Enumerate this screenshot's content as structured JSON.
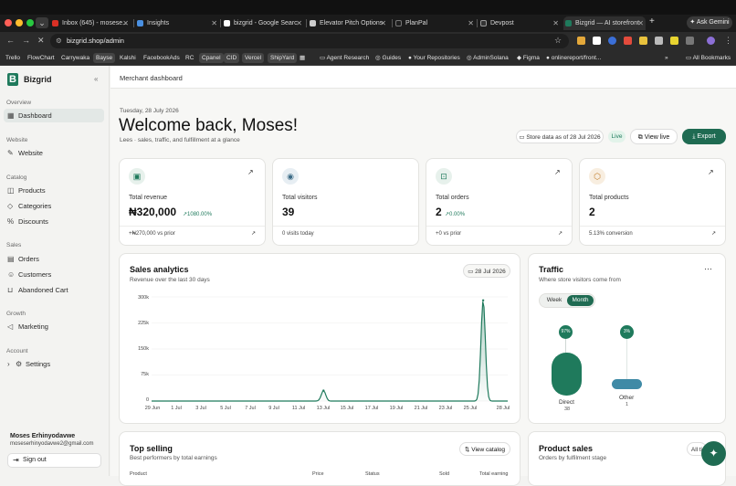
{
  "browser": {
    "tabs": [
      {
        "label": "Inbox (645) - mosese...",
        "fav": "#d93025"
      },
      {
        "label": "Insights",
        "fav": "#4a90e2"
      },
      {
        "label": "bizgrid - Google Searc",
        "fav": "#ffffff"
      },
      {
        "label": "Elevator Pitch Options",
        "fav": "#cccccc"
      },
      {
        "label": "PlanPal",
        "fav": "#1f1f1f"
      },
      {
        "label": "Devpost",
        "fav": "#333333"
      },
      {
        "label": "Bizgrid — AI storefront",
        "fav": "#1f7a5c"
      }
    ],
    "ask_gemini": "Ask Gemini",
    "url": "bizgrid.shop/admin",
    "bookmarks": [
      "Trello",
      "FlowChart",
      "Carrywaka",
      "Bayse",
      "Kalshi",
      "FacebookAds",
      "RC",
      "Cpanel",
      "CID",
      "Vercel",
      "ShipYard",
      "Agent Research",
      "Guides",
      "Your Repositories",
      "AdminSolana",
      "Figma",
      "onlinereport/front...",
      "All Bookmarks"
    ]
  },
  "sidebar": {
    "brand": "Bizgrid",
    "sections": {
      "overview": "Overview",
      "website": "Website",
      "catalog": "Catalog",
      "sales": "Sales",
      "growth": "Growth",
      "account": "Account"
    },
    "items": {
      "dashboard": "Dashboard",
      "website": "Website",
      "products": "Products",
      "categories": "Categories",
      "discounts": "Discounts",
      "orders": "Orders",
      "customers": "Customers",
      "abandoned": "Abandoned Cart",
      "marketing": "Marketing",
      "settings": "Settings"
    },
    "user": {
      "name": "Moses Erhinyodavwe",
      "email": "moseserhinyodavwe2@gmail.com"
    },
    "signout": "Sign out"
  },
  "header": {
    "breadcrumb": "Merchant dashboard"
  },
  "hero": {
    "date": "Tuesday, 28 July 2026",
    "title": "Welcome back, Moses!",
    "subtitle": "Lees · sales, traffic, and fulfillment at a glance",
    "store_data": "Store data as of 28 Jul 2026",
    "live": "Live",
    "view_live": "View live",
    "export": "Export"
  },
  "kpis": [
    {
      "label": "Total revenue",
      "value": "₦320,000",
      "delta": "↗1080.00%",
      "foot": "+₦270,000 vs prior"
    },
    {
      "label": "Total visitors",
      "value": "39",
      "delta": "",
      "foot": "0 visits today"
    },
    {
      "label": "Total orders",
      "value": "2",
      "delta": "↗0.00%",
      "foot": "+0 vs prior"
    },
    {
      "label": "Total products",
      "value": "2",
      "delta": "",
      "foot": "5.13% conversion"
    }
  ],
  "sales": {
    "title": "Sales analytics",
    "subtitle": "Revenue over the last 30 days",
    "date_chip": "28 Jul 2026"
  },
  "chart_data": {
    "type": "area",
    "title": "Sales analytics",
    "x": [
      "29 Jun",
      "30 Jun",
      "1 Jul",
      "2 Jul",
      "3 Jul",
      "4 Jul",
      "5 Jul",
      "6 Jul",
      "7 Jul",
      "8 Jul",
      "9 Jul",
      "10 Jul",
      "11 Jul",
      "12 Jul",
      "13 Jul",
      "14 Jul",
      "15 Jul",
      "16 Jul",
      "17 Jul",
      "18 Jul",
      "19 Jul",
      "20 Jul",
      "21 Jul",
      "22 Jul",
      "23 Jul",
      "24 Jul",
      "25 Jul",
      "26 Jul",
      "27 Jul",
      "28 Jul"
    ],
    "values": [
      0,
      0,
      0,
      0,
      0,
      0,
      0,
      0,
      0,
      0,
      0,
      0,
      0,
      0,
      30000,
      0,
      0,
      0,
      0,
      0,
      0,
      0,
      0,
      0,
      0,
      0,
      0,
      290000,
      0,
      0
    ],
    "xticks": [
      "29 Jun",
      "1 Jul",
      "3 Jul",
      "5 Jul",
      "7 Jul",
      "9 Jul",
      "11 Jul",
      "13 Jul",
      "15 Jul",
      "17 Jul",
      "19 Jul",
      "21 Jul",
      "23 Jul",
      "25 Jul",
      "28 Jul"
    ],
    "yticks": [
      "300k",
      "225k",
      "150k",
      "75k",
      "0"
    ],
    "ylim": [
      0,
      300000
    ],
    "color": "#1f7a5c"
  },
  "traffic": {
    "title": "Traffic",
    "subtitle": "Where store visitors come from",
    "week": "Week",
    "month": "Month",
    "direct": {
      "label": "Direct",
      "count": "38",
      "pct": "97%"
    },
    "other": {
      "label": "Other",
      "count": "1",
      "pct": "3%"
    }
  },
  "top_selling": {
    "title": "Top selling",
    "subtitle": "Best performers by total earnings",
    "view_catalog": "View catalog",
    "columns": [
      "Product",
      "Price",
      "Status",
      "Sold",
      "Total earning"
    ]
  },
  "product_sales": {
    "title": "Product sales",
    "subtitle": "Orders by fulfilment stage",
    "chip": "All ti"
  }
}
